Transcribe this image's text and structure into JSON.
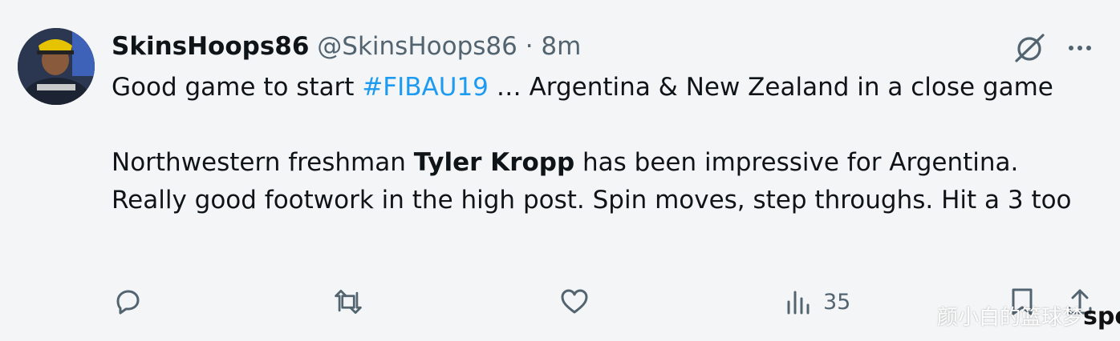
{
  "tweet": {
    "display_name": "SkinsHoops86",
    "handle": "@SkinsHoops86",
    "separator": "·",
    "timestamp": "8m",
    "text": {
      "line1_before": "Good game to start ",
      "line1_hashtag": "#FIBAU19",
      "line1_after": " … Argentina & New Zealand in a close game",
      "p2_before": "Northwestern freshman ",
      "p2_bold": "Tyler Kropp",
      "p2_after": " has been impressive for Argentina. Really good footwork in the high post. Spin moves, step throughs. Hit a 3 too"
    },
    "actions": {
      "views_count": "35"
    },
    "icons": [
      "avatar",
      "grok-icon",
      "more-icon",
      "reply-icon",
      "retweet-icon",
      "like-icon",
      "views-icon",
      "bookmark-icon",
      "share-icon"
    ]
  },
  "watermark": {
    "text": "颜小白的篮球梦",
    "brand": "sports"
  },
  "colors": {
    "background": "#f4f5f6",
    "text": "#0f1419",
    "secondary": "#536471",
    "link": "#1d9bf0"
  }
}
